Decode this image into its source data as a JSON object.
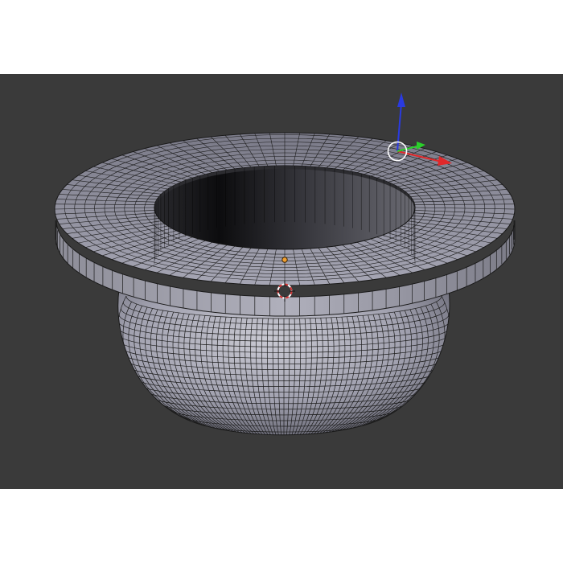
{
  "viewport": {
    "background_color": "#3a3a3a",
    "object": "mesh-bowl-with-brim",
    "mesh_color": "#8e8ea0",
    "wire_color": "#111111"
  },
  "gizmo": {
    "x_axis_color": "#e0282a",
    "y_axis_color": "#2ad02a",
    "z_axis_color": "#2a3ae0",
    "origin_ring_color": "#ffffff"
  },
  "markers": {
    "object_origin_color": "#f0a030",
    "cursor_3d_color": "#d03030"
  }
}
